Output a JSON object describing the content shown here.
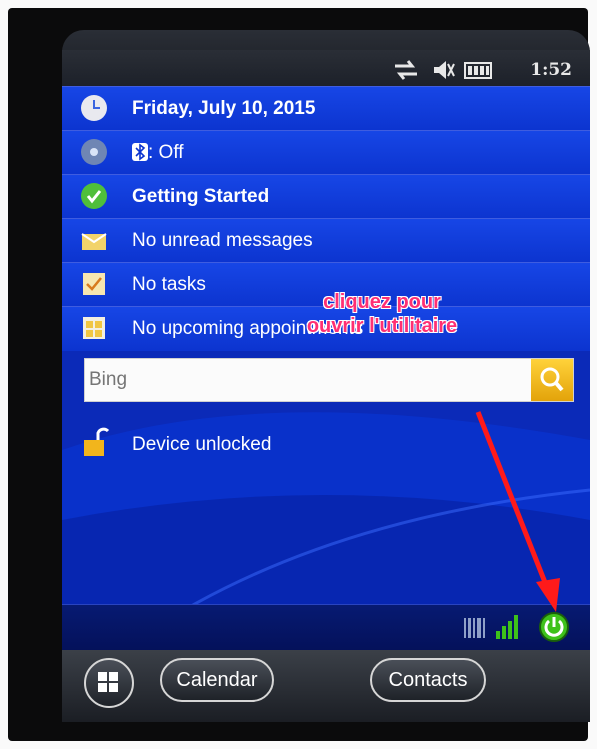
{
  "status": {
    "time": "1:52",
    "icons": [
      "sync-arrows-icon",
      "speaker-muted-icon",
      "battery-icon"
    ]
  },
  "today_items": [
    {
      "icon": "clock-icon",
      "label": "Friday, July 10, 2015",
      "bold": true
    },
    {
      "icon": "wireless-icon",
      "label": ": Off",
      "prefix_icon": "bluetooth-icon"
    },
    {
      "icon": "getting-started-icon",
      "label": "Getting Started",
      "bold": true
    },
    {
      "icon": "messaging-icon",
      "label": "No unread messages"
    },
    {
      "icon": "tasks-icon",
      "label": "No tasks"
    },
    {
      "icon": "calendar-icon",
      "label": "No upcoming appointments"
    }
  ],
  "search": {
    "placeholder": "Bing",
    "button_icon": "search-icon"
  },
  "device_lock": {
    "label": "Device unlocked",
    "icon": "unlocked-padlock-icon"
  },
  "annotation": {
    "line1": "cliquez pour",
    "line2": "ouvrir l'utilitaire"
  },
  "taskbar": {
    "icons": [
      "barcode-icon",
      "signal-strength-icon",
      "power-utility-icon"
    ]
  },
  "softkeys": {
    "start_icon": "windows-start-icon",
    "left": "Calendar",
    "right": "Contacts"
  },
  "colors": {
    "screen_blue": "#0b2ab8",
    "row_blue": "#1746e6",
    "annotation_pink": "#ff2f73",
    "arrow_red": "#ff1a1a",
    "signal_green": "#3ec21a"
  }
}
